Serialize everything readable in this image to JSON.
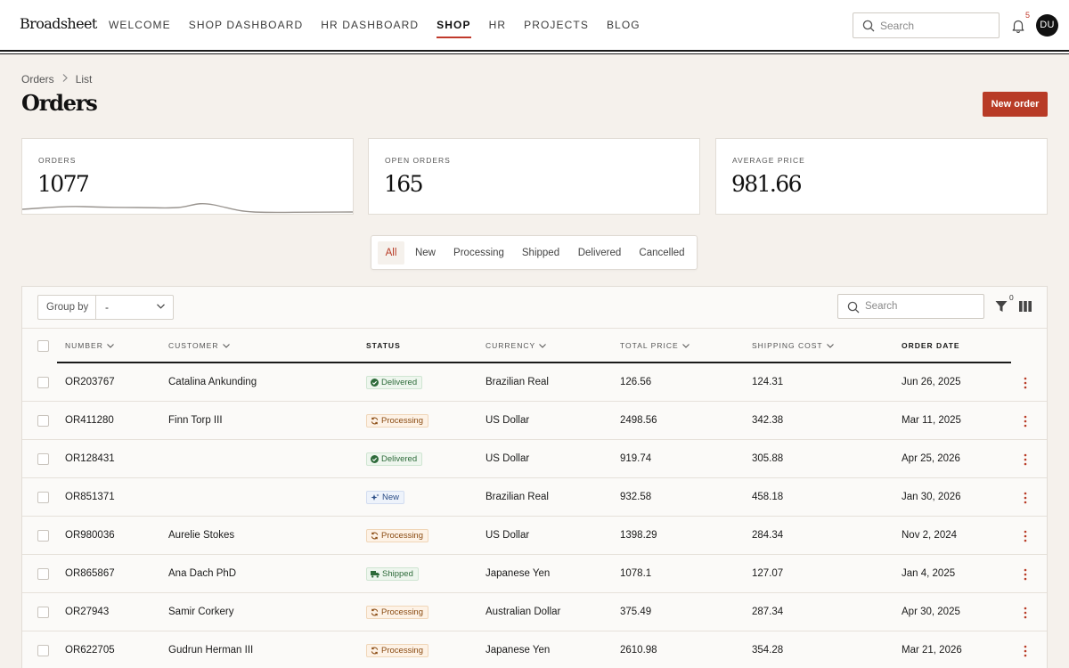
{
  "brand": "Broadsheet",
  "nav": [
    {
      "label": "WELCOME"
    },
    {
      "label": "SHOP DASHBOARD"
    },
    {
      "label": "HR DASHBOARD"
    },
    {
      "label": "SHOP",
      "active": true
    },
    {
      "label": "HR"
    },
    {
      "label": "PROJECTS"
    },
    {
      "label": "BLOG"
    }
  ],
  "header": {
    "search_placeholder": "Search",
    "notification_count": "5",
    "avatar_initials": "DU"
  },
  "breadcrumb": [
    "Orders",
    "List"
  ],
  "page_title": "Orders",
  "new_order_label": "New order",
  "stats": [
    {
      "label": "ORDERS",
      "value": "1077"
    },
    {
      "label": "OPEN ORDERS",
      "value": "165"
    },
    {
      "label": "AVERAGE PRICE",
      "value": "981.66"
    }
  ],
  "status_tabs": [
    {
      "label": "All",
      "active": true
    },
    {
      "label": "New"
    },
    {
      "label": "Processing"
    },
    {
      "label": "Shipped"
    },
    {
      "label": "Delivered"
    },
    {
      "label": "Cancelled"
    }
  ],
  "toolbar": {
    "group_by_label": "Group by",
    "group_by_value": "-",
    "search_placeholder": "Search",
    "filter_count": "0"
  },
  "columns": [
    {
      "key": "number",
      "label": "NUMBER",
      "sortable": true
    },
    {
      "key": "customer",
      "label": "CUSTOMER",
      "sortable": true
    },
    {
      "key": "status",
      "label": "STATUS",
      "sortable": false
    },
    {
      "key": "currency",
      "label": "CURRENCY",
      "sortable": true
    },
    {
      "key": "total_price",
      "label": "TOTAL PRICE",
      "sortable": true
    },
    {
      "key": "shipping_cost",
      "label": "SHIPPING COST",
      "sortable": true
    },
    {
      "key": "order_date",
      "label": "ORDER DATE",
      "sortable": false
    }
  ],
  "orders": [
    {
      "number": "OR203767",
      "customer": "Catalina Ankunding",
      "status": "Delivered",
      "currency": "Brazilian Real",
      "total_price": "126.56",
      "shipping_cost": "124.31",
      "order_date": "Jun 26, 2025"
    },
    {
      "number": "OR411280",
      "customer": "Finn Torp III",
      "status": "Processing",
      "currency": "US Dollar",
      "total_price": "2498.56",
      "shipping_cost": "342.38",
      "order_date": "Mar 11, 2025"
    },
    {
      "number": "OR128431",
      "customer": "",
      "status": "Delivered",
      "currency": "US Dollar",
      "total_price": "919.74",
      "shipping_cost": "305.88",
      "order_date": "Apr 25, 2026"
    },
    {
      "number": "OR851371",
      "customer": "",
      "status": "New",
      "currency": "Brazilian Real",
      "total_price": "932.58",
      "shipping_cost": "458.18",
      "order_date": "Jan 30, 2026"
    },
    {
      "number": "OR980036",
      "customer": "Aurelie Stokes",
      "status": "Processing",
      "currency": "US Dollar",
      "total_price": "1398.29",
      "shipping_cost": "284.34",
      "order_date": "Nov 2, 2024"
    },
    {
      "number": "OR865867",
      "customer": "Ana Dach PhD",
      "status": "Shipped",
      "currency": "Japanese Yen",
      "total_price": "1078.1",
      "shipping_cost": "127.07",
      "order_date": "Jan 4, 2025"
    },
    {
      "number": "OR27943",
      "customer": "Samir Corkery",
      "status": "Processing",
      "currency": "Australian Dollar",
      "total_price": "375.49",
      "shipping_cost": "287.34",
      "order_date": "Apr 30, 2025"
    },
    {
      "number": "OR622705",
      "customer": "Gudrun Herman III",
      "status": "Processing",
      "currency": "Japanese Yen",
      "total_price": "2610.98",
      "shipping_cost": "354.28",
      "order_date": "Mar 21, 2026"
    }
  ],
  "colors": {
    "accent": "#b83b26",
    "background": "#f5f1ec",
    "delivered": "#2e6b3a",
    "processing": "#8a4b12",
    "new": "#2b4d86"
  }
}
